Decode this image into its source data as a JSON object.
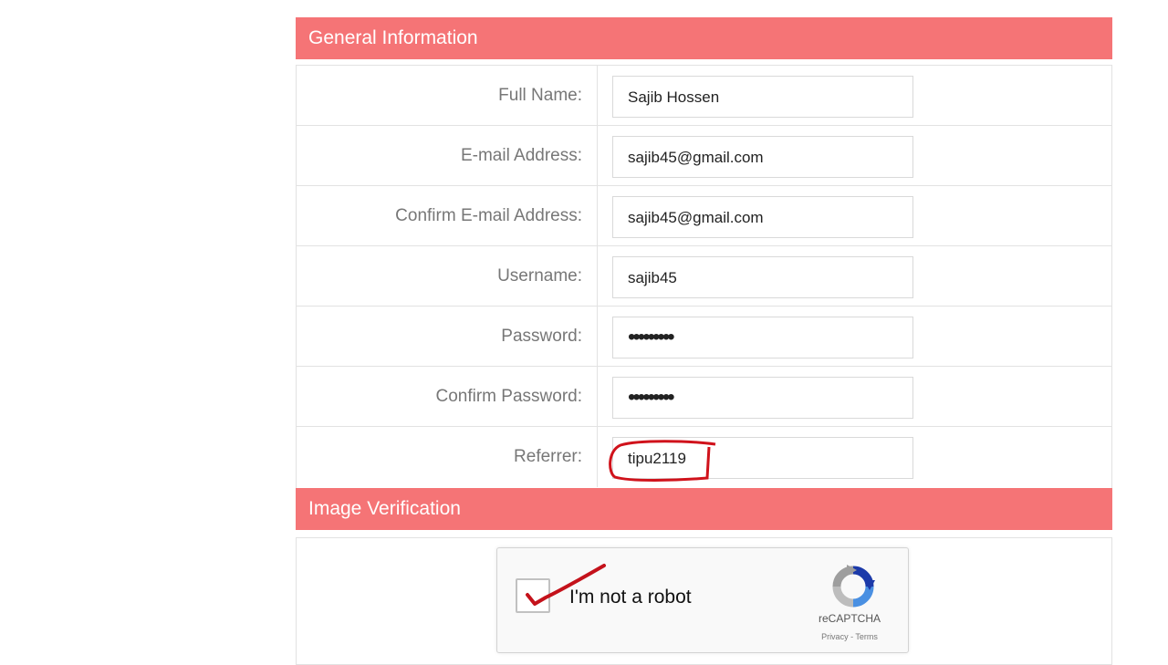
{
  "sections": {
    "general_title": "General Information",
    "image_title": "Image Verification"
  },
  "fields": [
    {
      "label": "Full Name:",
      "value": "Sajib Hossen"
    },
    {
      "label": "E-mail Address:",
      "value": "sajib45@gmail.com"
    },
    {
      "label": "Confirm E-mail Address:",
      "value": "sajib45@gmail.com"
    },
    {
      "label": "Username:",
      "value": "sajib45"
    },
    {
      "label": "Password:",
      "value": "•••••••••"
    },
    {
      "label": "Confirm Password:",
      "value": "•••••••••"
    },
    {
      "label": "Referrer:",
      "value": "tipu2119"
    }
  ],
  "captcha": {
    "label": "I'm not a robot",
    "brand": "reCAPTCHA",
    "privacy": "Privacy",
    "separator": " - ",
    "terms": "Terms"
  },
  "colors": {
    "header_bg": "#f57476",
    "annotation": "#d0121b"
  }
}
